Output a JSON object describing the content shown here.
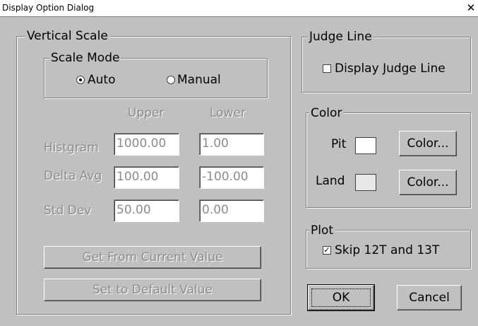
{
  "window": {
    "title": "Display Option Dialog",
    "close_glyph": "✕"
  },
  "vertical_scale": {
    "legend": "Vertical Scale",
    "scale_mode": {
      "legend": "Scale Mode",
      "options": [
        {
          "label": "Auto",
          "selected": true
        },
        {
          "label": "Manual",
          "selected": false
        }
      ]
    },
    "columns": {
      "upper": "Upper",
      "lower": "Lower"
    },
    "rows": [
      {
        "label": "Histgram",
        "upper": "1000.00",
        "lower": "1.00"
      },
      {
        "label": "Delta Avg",
        "upper": "100.00",
        "lower": "-100.00"
      },
      {
        "label": "Std Dev",
        "upper": "50.00",
        "lower": "0.00"
      }
    ],
    "get_current_label": "Get From Current Value",
    "set_default_label": "Set to Default Value",
    "enabled": false
  },
  "judge_line": {
    "legend": "Judge Line",
    "checkbox_label": "Display Judge Line",
    "checked": false
  },
  "color": {
    "legend": "Color",
    "items": [
      {
        "label": "Pit",
        "swatch": "#ffffff",
        "button": "Color..."
      },
      {
        "label": "Land",
        "swatch": "#e8e8e8",
        "button": "Color..."
      }
    ]
  },
  "plot": {
    "legend": "Plot",
    "checkbox_label": "Skip 12T and 13T",
    "checked": true
  },
  "buttons": {
    "ok": "OK",
    "cancel": "Cancel"
  },
  "colors": {
    "face": "#c0c0c0",
    "disabled_text": "#8c8c8c"
  }
}
